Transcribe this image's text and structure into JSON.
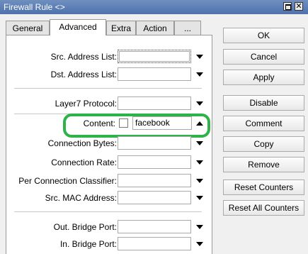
{
  "window": {
    "title": "Firewall Rule <>",
    "close_glyph": "✕"
  },
  "tabs": [
    "General",
    "Advanced",
    "Extra",
    "Action",
    "..."
  ],
  "active_tab": "Advanced",
  "fields": {
    "src_address_list": "Src. Address List:",
    "dst_address_list": "Dst. Address List:",
    "layer7_protocol": "Layer7 Protocol:",
    "content": "Content:",
    "content_value": "facebook",
    "connection_bytes": "Connection Bytes:",
    "connection_rate": "Connection Rate:",
    "per_connection_classifier": "Per Connection Classifier:",
    "src_mac_address": "Src. MAC Address:",
    "out_bridge_port": "Out. Bridge Port:",
    "in_bridge_port": "In. Bridge Port:"
  },
  "buttons": {
    "ok": "OK",
    "cancel": "Cancel",
    "apply": "Apply",
    "disable": "Disable",
    "comment": "Comment",
    "copy": "Copy",
    "remove": "Remove",
    "reset_counters": "Reset Counters",
    "reset_all_counters": "Reset All Counters"
  },
  "colors": {
    "highlight": "#2db34a",
    "titlebar": "#4f72ad"
  },
  "icons": [
    "maximize-icon",
    "close-icon",
    "dropdown-arrow-icon",
    "dropdown-up-arrow-icon"
  ]
}
